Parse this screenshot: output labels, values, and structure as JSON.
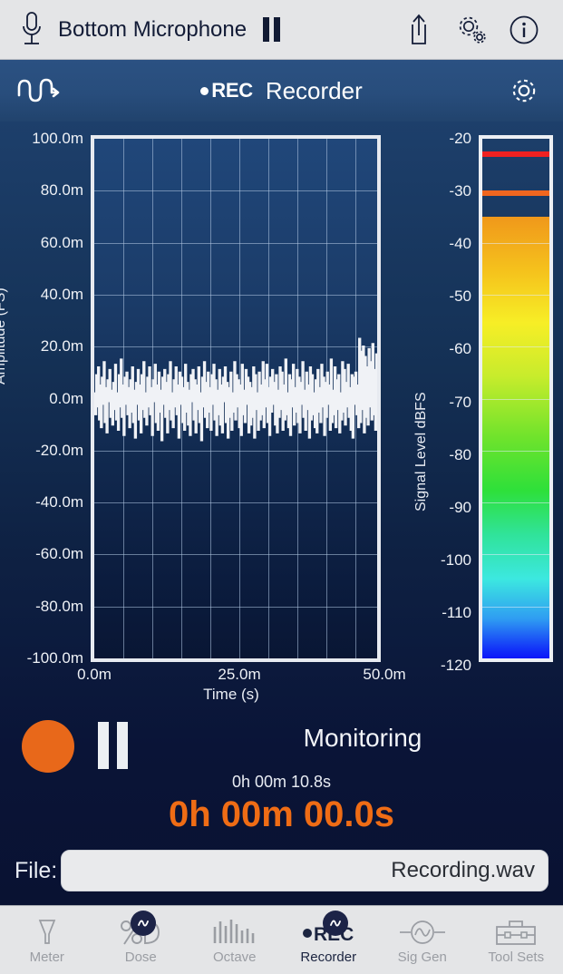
{
  "topbar": {
    "mic_icon": "microphone-icon",
    "device_name": "Bottom Microphone",
    "pause_icon": "pause-icon",
    "share_icon": "share-icon",
    "settings_icon": "gears-icon",
    "info_icon": "info-icon"
  },
  "header": {
    "signal_flow_icon": "waveform-arrow-icon",
    "rec_label": "REC",
    "title": "Recorder",
    "gear_icon": "gear-icon"
  },
  "chart_data": {
    "type": "line",
    "title": "",
    "xlabel": "Time (s)",
    "ylabel": "Amplitude (FS)",
    "xlim": [
      0,
      50
    ],
    "ylim": [
      -100,
      100
    ],
    "xticks": [
      "0.0m",
      "25.0m",
      "50.0m"
    ],
    "xtick_values": [
      0,
      25,
      50
    ],
    "yticks": [
      "100.0m",
      "80.0m",
      "60.0m",
      "40.0m",
      "20.0m",
      "0.0m",
      "-20.0m",
      "-40.0m",
      "-60.0m",
      "-80.0m",
      "-100.0m"
    ],
    "ytick_values": [
      100,
      80,
      60,
      40,
      20,
      0,
      -20,
      -40,
      -60,
      -80,
      -100
    ],
    "grid": true,
    "grid_columns": 10,
    "series": [
      {
        "name": "Waveform",
        "color": "#f0f2f6",
        "description": "Broadband noise signal centred on 0.0m FS, peak excursions roughly +23m to -25m",
        "values": [
          2,
          -6,
          9,
          -3,
          12,
          -8,
          5,
          -11,
          8,
          -2,
          14,
          -9,
          4,
          -13,
          7,
          -1,
          11,
          -7,
          3,
          -10,
          6,
          -4,
          13,
          -8,
          2,
          -12,
          9,
          -3,
          15,
          -7,
          5,
          -14,
          8,
          -2,
          10,
          -6,
          4,
          -11,
          7,
          -5,
          12,
          -9,
          3,
          -15,
          6,
          -2,
          11,
          -8,
          5,
          -13,
          9,
          -4,
          14,
          -7,
          2,
          -10,
          8,
          -3,
          12,
          -6,
          4,
          -14,
          7,
          -1,
          13,
          -9,
          5,
          -12,
          10,
          -5,
          3,
          -16,
          8,
          -2,
          11,
          -7,
          6,
          -13,
          9,
          -4,
          14,
          -8,
          2,
          -11,
          7,
          -3,
          12,
          -6,
          5,
          -15,
          10,
          -2,
          8,
          -9,
          4,
          -12,
          13,
          -5,
          6,
          -10,
          3,
          -14,
          9,
          -1,
          11,
          -8,
          7,
          -13,
          5,
          -4,
          12,
          -9,
          2,
          -16,
          8,
          -3,
          14,
          -7,
          6,
          -11,
          10,
          -5,
          4,
          -12,
          9,
          -2,
          13,
          -8,
          7,
          -14,
          3,
          -6,
          11,
          -10,
          5,
          -13,
          8,
          -1,
          12,
          -9,
          6,
          -15,
          4,
          -7,
          10,
          -12,
          2,
          -5,
          14,
          -8,
          9,
          -3,
          7,
          -11,
          5,
          -14,
          13,
          -6,
          3,
          -9,
          11,
          -2,
          8,
          -13,
          6,
          -10,
          4,
          -7,
          12,
          -15,
          9,
          -4,
          2,
          -12,
          10,
          -8,
          5,
          -6,
          14,
          -11,
          7,
          -3,
          13,
          -9,
          4,
          -14,
          8,
          -5,
          11,
          -2,
          6,
          -10,
          9,
          -13,
          3,
          -7,
          12,
          -4,
          10,
          -12,
          5,
          -8,
          15,
          -6,
          2,
          -11,
          9,
          -14,
          7,
          -3,
          13,
          -10,
          4,
          -5,
          11,
          -9,
          8,
          -13,
          6,
          -2,
          14,
          -7,
          3,
          -12,
          10,
          -4,
          5,
          -15,
          12,
          -8,
          9,
          -6,
          2,
          -11,
          7,
          -13,
          11,
          -5,
          4,
          -9,
          13,
          -3,
          8,
          -14,
          6,
          -7,
          10,
          -2,
          5,
          -12,
          15,
          -9,
          3,
          -6,
          12,
          -11,
          7,
          -4,
          9,
          -13,
          2,
          -8,
          14,
          -5,
          11,
          -10,
          6,
          -3,
          13,
          -7,
          4,
          -12,
          9,
          -15,
          8,
          -2,
          10,
          -6,
          5,
          -11,
          23,
          -9,
          18,
          -4,
          20,
          -13,
          16,
          -7,
          12,
          -10,
          19,
          -3,
          14,
          -8,
          21,
          -6,
          11,
          -12,
          17,
          -5
        ]
      }
    ]
  },
  "level_meter": {
    "label": "Signal Level dBFS",
    "ticks": [
      "-20",
      "-30",
      "-40",
      "-50",
      "-60",
      "-70",
      "-80",
      "-90",
      "-100",
      "-110",
      "-120"
    ],
    "tick_values": [
      -20,
      -30,
      -40,
      -50,
      -60,
      -70,
      -80,
      -90,
      -100,
      -110,
      -120
    ],
    "range": [
      -120,
      -20
    ],
    "current_level": -35.0,
    "peak_hold": -22.5,
    "peak_hold_color": "#ef2121",
    "secondary_marker": -30.0,
    "secondary_marker_color": "#f0661f"
  },
  "transport": {
    "record_icon": "record-circle-icon",
    "record_color": "#e8681a",
    "pause_icon": "pause-icon",
    "status": "Monitoring",
    "elapsed_small": "0h 00m 10.8s",
    "timer": "0h 00m 00.0s",
    "timer_color": "#ef6c15"
  },
  "file": {
    "label": "File:",
    "value": "Recording.wav",
    "placeholder": "Recording.wav"
  },
  "tabbar": {
    "tabs": [
      {
        "label": "Meter",
        "icon": "funnel-icon",
        "active": false,
        "badge": false
      },
      {
        "label": "Dose",
        "icon": "percent-d-icon",
        "active": false,
        "badge": true
      },
      {
        "label": "Octave",
        "icon": "bars-icon",
        "active": false,
        "badge": false
      },
      {
        "label": "Recorder",
        "icon": "rec-icon",
        "active": true,
        "badge": true
      },
      {
        "label": "Sig Gen",
        "icon": "sine-icon",
        "active": false,
        "badge": false
      },
      {
        "label": "Tool Sets",
        "icon": "toolbox-icon",
        "active": false,
        "badge": false
      }
    ]
  }
}
